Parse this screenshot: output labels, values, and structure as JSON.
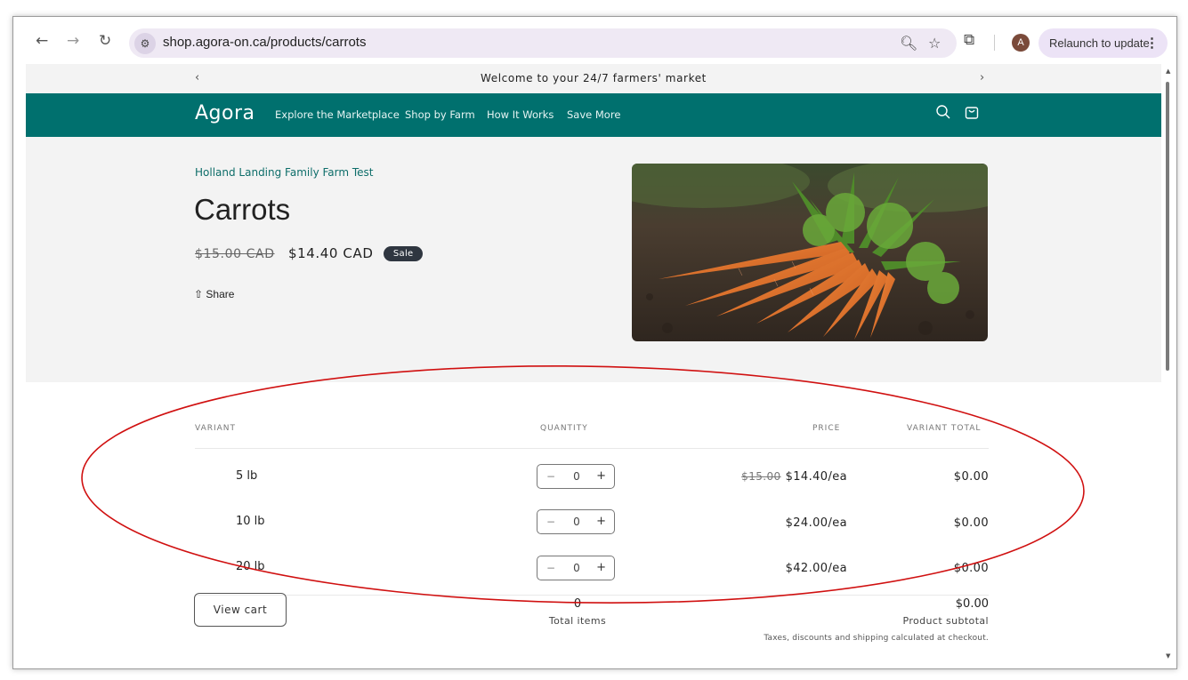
{
  "browser": {
    "url": "shop.agora-on.ca/products/carrots",
    "relaunch_label": "Relaunch to update",
    "avatar_letter": "A"
  },
  "announcement": {
    "text": "Welcome to your 24/7 farmers' market"
  },
  "header": {
    "brand": "Agora",
    "nav": [
      "Explore the Marketplace",
      "Shop by Farm",
      "How It Works",
      "Save More"
    ]
  },
  "product": {
    "vendor": "Holland Landing Family Farm Test",
    "title": "Carrots",
    "compare_price": "$15.00 CAD",
    "price": "$14.40 CAD",
    "badge": "Sale",
    "share_label": "Share"
  },
  "variant_table": {
    "headers": {
      "variant": "VARIANT",
      "quantity": "QUANTITY",
      "price": "PRICE",
      "total": "VARIANT TOTAL"
    },
    "rows": [
      {
        "variant": "5 lb",
        "qty": "0",
        "compare": "$15.00",
        "price": "$14.40/ea",
        "total": "$0.00"
      },
      {
        "variant": "10 lb",
        "qty": "0",
        "compare": "",
        "price": "$24.00/ea",
        "total": "$0.00"
      },
      {
        "variant": "20 lb",
        "qty": "0",
        "compare": "",
        "price": "$42.00/ea",
        "total": "$0.00"
      }
    ],
    "view_cart": "View cart",
    "total_items": "0",
    "total_items_label": "Total items",
    "subtotal": "$0.00",
    "subtotal_label": "Product subtotal",
    "tax_note": "Taxes, discounts and shipping calculated at checkout."
  },
  "colors": {
    "brand_teal": "#00706e",
    "annotation_red": "#d01010"
  }
}
